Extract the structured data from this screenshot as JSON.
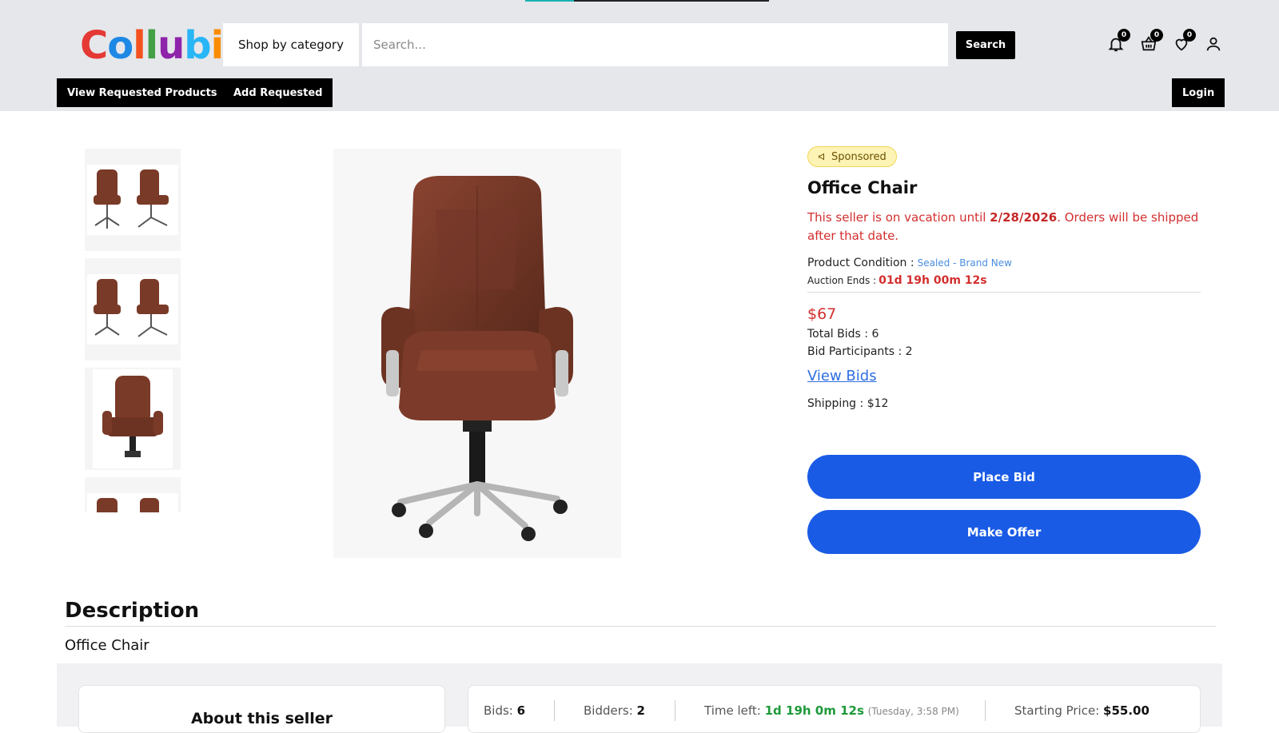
{
  "header": {
    "logo_text": "Collubi",
    "shop_by_category": "Shop by category",
    "search_placeholder": "Search...",
    "search_button": "Search",
    "notifications_count": "0",
    "cart_count": "0",
    "wishlist_count": "0",
    "page_load_progress": 0.2
  },
  "nav": {
    "view_requested": "View Requested Products",
    "add_requested": "Add Requested",
    "login": "Login"
  },
  "product": {
    "sponsored": "Sponsored",
    "title": "Office Chair",
    "vacation_prefix": "This seller is on vacation until ",
    "vacation_date": "2/28/2026",
    "vacation_suffix": ". Orders will be shipped after that date.",
    "condition_label": "Product Condition :",
    "condition_value": "Sealed - Brand New",
    "auction_label": "Auction Ends :",
    "auction_value": "01d 19h 00m 12s",
    "price": "$67",
    "total_bids": "Total Bids : 6",
    "bid_participants": "Bid Participants : 2",
    "view_bids": "View Bids",
    "shipping": "Shipping : $12",
    "place_bid": "Place Bid",
    "make_offer": "Make Offer"
  },
  "description": {
    "heading": "Description",
    "text": "Office Chair"
  },
  "seller": {
    "heading": "About this seller"
  },
  "stats": {
    "bids_label": "Bids:",
    "bids_value": "6",
    "bidders_label": "Bidders:",
    "bidders_value": "2",
    "time_left_label": "Time left:",
    "time_left_value": "1d 19h 0m 12s",
    "time_left_note": "(Tuesday, 3:58 PM)",
    "starting_label": "Starting Price:",
    "starting_value": "$55.00"
  },
  "colors": {
    "accent_blue": "#1a5be6",
    "alert_red": "#d32f2f",
    "link_blue": "#2f6fe0",
    "success_green": "#1e9a3a"
  }
}
